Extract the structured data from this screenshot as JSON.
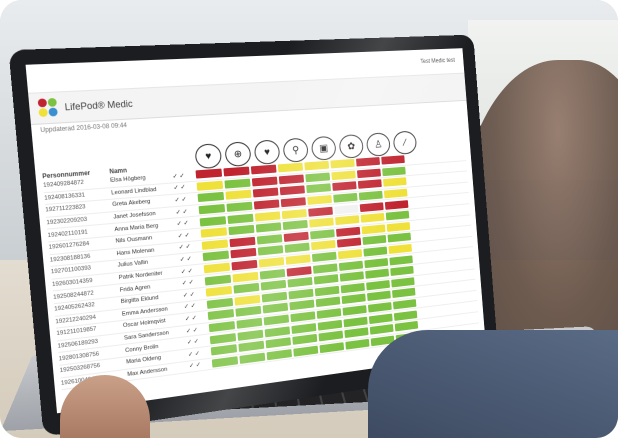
{
  "app": {
    "title": "LifePod® Medic",
    "user_menu": "Test Medic test"
  },
  "updated": "Uppdaterad 2016-03-08 09:44",
  "columns": {
    "person": "Personnummer",
    "name": "Namn",
    "icons": [
      "heart-icon",
      "medicine-icon",
      "shield-heart-icon",
      "walking-icon",
      "calendar-icon",
      "care-icon",
      "person-alert-icon",
      "pill-icon"
    ]
  },
  "icon_glyphs": [
    "♥",
    "⊕",
    "♥",
    "⚲",
    "▣",
    "✿",
    "♙",
    "⁄"
  ],
  "colors": {
    "red": "#c0242f",
    "yellow": "#efe13a",
    "green": "#7cc242",
    "light": "#f1f1f1"
  },
  "rows": [
    {
      "pnum": "192409284872",
      "name": "Elsa Högberg",
      "check": "✓ ✓",
      "cells": [
        "red",
        "red",
        "red",
        "yellow",
        "yellow",
        "yellow",
        "red",
        "red"
      ]
    },
    {
      "pnum": "192408136331",
      "name": "Leonard Lindblad",
      "check": "✓ ✓",
      "cells": [
        "yellow",
        "green",
        "red",
        "red",
        "green",
        "yellow",
        "red",
        "green"
      ]
    },
    {
      "pnum": "192711223823",
      "name": "Greta Åkeberg",
      "check": "✓ ✓",
      "cells": [
        "green",
        "yellow",
        "red",
        "red",
        "green",
        "red",
        "red",
        "yellow"
      ]
    },
    {
      "pnum": "192302209203",
      "name": "Janet Josefsson",
      "check": "✓ ✓",
      "cells": [
        "green",
        "green",
        "red",
        "red",
        "yellow",
        "green",
        "green",
        "yellow"
      ]
    },
    {
      "pnum": "192402110191",
      "name": "Anna Maria Berg",
      "check": "✓ ✓",
      "cells": [
        "green",
        "green",
        "yellow",
        "yellow",
        "red",
        "light",
        "red",
        "red"
      ]
    },
    {
      "pnum": "192601276284",
      "name": "Nils Ousmann",
      "check": "✓ ✓",
      "cells": [
        "yellow",
        "green",
        "green",
        "green",
        "yellow",
        "yellow",
        "yellow",
        "green"
      ]
    },
    {
      "pnum": "192308188136",
      "name": "Hans Molenan",
      "check": "✓ ✓",
      "cells": [
        "yellow",
        "red",
        "green",
        "red",
        "green",
        "red",
        "yellow",
        "yellow"
      ]
    },
    {
      "pnum": "192701100393",
      "name": "Julius Vallin",
      "check": "✓ ✓",
      "cells": [
        "green",
        "red",
        "green",
        "green",
        "yellow",
        "red",
        "green",
        "green"
      ]
    },
    {
      "pnum": "192603014359",
      "name": "Patrik Nordeniter",
      "check": "✓ ✓",
      "cells": [
        "yellow",
        "red",
        "yellow",
        "yellow",
        "green",
        "yellow",
        "green",
        "yellow"
      ]
    },
    {
      "pnum": "192508244872",
      "name": "Frida Ågren",
      "check": "✓ ✓",
      "cells": [
        "green",
        "yellow",
        "green",
        "red",
        "green",
        "green",
        "green",
        "green"
      ]
    },
    {
      "pnum": "192405262432",
      "name": "Birgitta Eklund",
      "check": "✓ ✓",
      "cells": [
        "yellow",
        "green",
        "green",
        "green",
        "green",
        "green",
        "green",
        "green"
      ]
    },
    {
      "pnum": "192212240294",
      "name": "Emma Andersson",
      "check": "✓ ✓",
      "cells": [
        "green",
        "yellow",
        "green",
        "green",
        "green",
        "green",
        "green",
        "green"
      ]
    },
    {
      "pnum": "191211019857",
      "name": "Oscar Holmqvist",
      "check": "✓ ✓",
      "cells": [
        "green",
        "green",
        "green",
        "green",
        "green",
        "green",
        "green",
        "green"
      ]
    },
    {
      "pnum": "192506189293",
      "name": "Sara Sandersson",
      "check": "✓ ✓",
      "cells": [
        "green",
        "green",
        "green",
        "green",
        "green",
        "green",
        "green",
        "green"
      ]
    },
    {
      "pnum": "192801308756",
      "name": "Conny Brolin",
      "check": "✓ ✓",
      "cells": [
        "green",
        "green",
        "green",
        "green",
        "green",
        "green",
        "green",
        "green"
      ]
    },
    {
      "pnum": "192503268756",
      "name": "Maria Oldeng",
      "check": "✓ ✓",
      "cells": [
        "green",
        "green",
        "green",
        "green",
        "green",
        "green",
        "green",
        "green"
      ]
    },
    {
      "pnum": "192610040458",
      "name": "Max Andersson",
      "check": "✓ ✓",
      "cells": [
        "green",
        "green",
        "green",
        "green",
        "green",
        "green",
        "green",
        "green"
      ]
    }
  ]
}
